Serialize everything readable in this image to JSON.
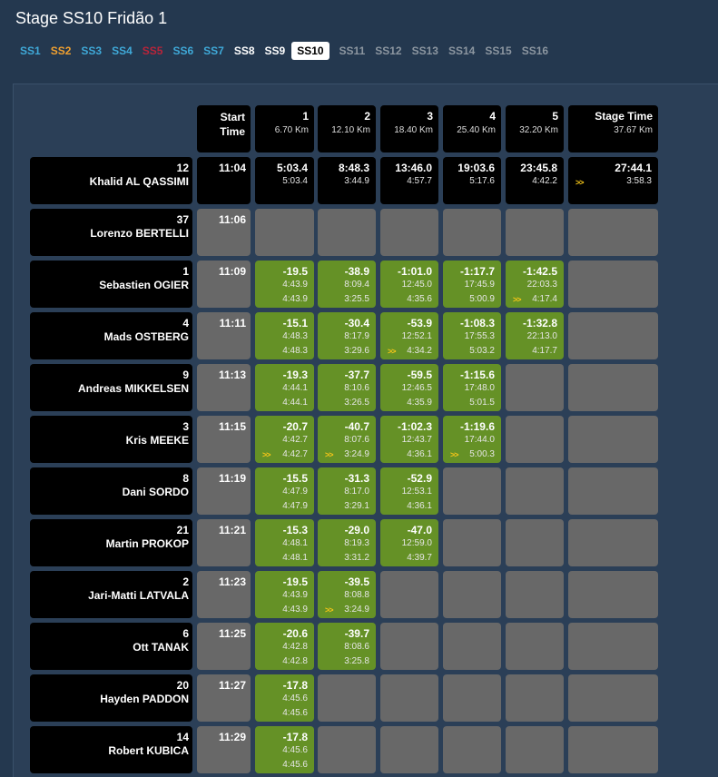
{
  "title": "Stage SS10 Fridão 1",
  "tabs": [
    {
      "label": "SS1",
      "color": "#3fa9d8",
      "active": false
    },
    {
      "label": "SS2",
      "color": "#f0a030",
      "active": false
    },
    {
      "label": "SS3",
      "color": "#3fa9d8",
      "active": false
    },
    {
      "label": "SS4",
      "color": "#3fa9d8",
      "active": false
    },
    {
      "label": "SS5",
      "color": "#b8243a",
      "active": false
    },
    {
      "label": "SS6",
      "color": "#3fa9d8",
      "active": false
    },
    {
      "label": "SS7",
      "color": "#3fa9d8",
      "active": false
    },
    {
      "label": "SS8",
      "color": "#ffffff",
      "active": false
    },
    {
      "label": "SS9",
      "color": "#ffffff",
      "active": false
    },
    {
      "label": "SS10",
      "color": "#000000",
      "active": true
    },
    {
      "label": "SS11",
      "color": "#8c96a0",
      "active": false
    },
    {
      "label": "SS12",
      "color": "#8c96a0",
      "active": false
    },
    {
      "label": "SS13",
      "color": "#8c96a0",
      "active": false
    },
    {
      "label": "SS14",
      "color": "#8c96a0",
      "active": false
    },
    {
      "label": "SS15",
      "color": "#8c96a0",
      "active": false
    },
    {
      "label": "SS16",
      "color": "#8c96a0",
      "active": false
    }
  ],
  "columns": {
    "start": {
      "line1": "Start",
      "line2": "Time"
    },
    "splits": [
      {
        "num": "1",
        "dist": "6.70 Km"
      },
      {
        "num": "2",
        "dist": "12.10 Km"
      },
      {
        "num": "3",
        "dist": "18.40 Km"
      },
      {
        "num": "4",
        "dist": "25.40 Km"
      },
      {
        "num": "5",
        "dist": "32.20 Km"
      }
    ],
    "stage": {
      "label": "Stage Time",
      "dist": "37.67 Km"
    }
  },
  "colors": {
    "black": "#000000",
    "grey": "#686868",
    "green": "#659126",
    "arrow": "#f5c518"
  },
  "leader": {
    "num": "12",
    "name": "Khalid AL QASSIMI",
    "start": "11:04",
    "splits": [
      {
        "v1": "5:03.4",
        "v2": "5:03.4",
        "arrow": false
      },
      {
        "v1": "8:48.3",
        "v2": "3:44.9",
        "arrow": false
      },
      {
        "v1": "13:46.0",
        "v2": "4:57.7",
        "arrow": false
      },
      {
        "v1": "19:03.6",
        "v2": "5:17.6",
        "arrow": false
      },
      {
        "v1": "23:45.8",
        "v2": "4:42.2",
        "arrow": false
      }
    ],
    "stage": {
      "v1": "27:44.1",
      "v2": "3:58.3",
      "arrow": true
    }
  },
  "drivers": [
    {
      "num": "37",
      "name": "Lorenzo BERTELLI",
      "start": "11:06",
      "splits": []
    },
    {
      "num": "1",
      "name": "Sebastien OGIER",
      "start": "11:09",
      "splits": [
        {
          "v1": "-19.5",
          "v2": "4:43.9",
          "v3": "4:43.9",
          "arrow": false
        },
        {
          "v1": "-38.9",
          "v2": "8:09.4",
          "v3": "3:25.5",
          "arrow": false
        },
        {
          "v1": "-1:01.0",
          "v2": "12:45.0",
          "v3": "4:35.6",
          "arrow": false
        },
        {
          "v1": "-1:17.7",
          "v2": "17:45.9",
          "v3": "5:00.9",
          "arrow": false
        },
        {
          "v1": "-1:42.5",
          "v2": "22:03.3",
          "v3": "4:17.4",
          "arrow": true
        }
      ]
    },
    {
      "num": "4",
      "name": "Mads OSTBERG",
      "start": "11:11",
      "splits": [
        {
          "v1": "-15.1",
          "v2": "4:48.3",
          "v3": "4:48.3",
          "arrow": false
        },
        {
          "v1": "-30.4",
          "v2": "8:17.9",
          "v3": "3:29.6",
          "arrow": false
        },
        {
          "v1": "-53.9",
          "v2": "12:52.1",
          "v3": "4:34.2",
          "arrow": true
        },
        {
          "v1": "-1:08.3",
          "v2": "17:55.3",
          "v3": "5:03.2",
          "arrow": false
        },
        {
          "v1": "-1:32.8",
          "v2": "22:13.0",
          "v3": "4:17.7",
          "arrow": false
        }
      ]
    },
    {
      "num": "9",
      "name": "Andreas MIKKELSEN",
      "start": "11:13",
      "splits": [
        {
          "v1": "-19.3",
          "v2": "4:44.1",
          "v3": "4:44.1",
          "arrow": false
        },
        {
          "v1": "-37.7",
          "v2": "8:10.6",
          "v3": "3:26.5",
          "arrow": false
        },
        {
          "v1": "-59.5",
          "v2": "12:46.5",
          "v3": "4:35.9",
          "arrow": false
        },
        {
          "v1": "-1:15.6",
          "v2": "17:48.0",
          "v3": "5:01.5",
          "arrow": false
        }
      ]
    },
    {
      "num": "3",
      "name": "Kris MEEKE",
      "start": "11:15",
      "splits": [
        {
          "v1": "-20.7",
          "v2": "4:42.7",
          "v3": "4:42.7",
          "arrow": true
        },
        {
          "v1": "-40.7",
          "v2": "8:07.6",
          "v3": "3:24.9",
          "arrow": true
        },
        {
          "v1": "-1:02.3",
          "v2": "12:43.7",
          "v3": "4:36.1",
          "arrow": false
        },
        {
          "v1": "-1:19.6",
          "v2": "17:44.0",
          "v3": "5:00.3",
          "arrow": true
        }
      ]
    },
    {
      "num": "8",
      "name": "Dani SORDO",
      "start": "11:19",
      "splits": [
        {
          "v1": "-15.5",
          "v2": "4:47.9",
          "v3": "4:47.9",
          "arrow": false
        },
        {
          "v1": "-31.3",
          "v2": "8:17.0",
          "v3": "3:29.1",
          "arrow": false
        },
        {
          "v1": "-52.9",
          "v2": "12:53.1",
          "v3": "4:36.1",
          "arrow": false
        }
      ]
    },
    {
      "num": "21",
      "name": "Martin PROKOP",
      "start": "11:21",
      "splits": [
        {
          "v1": "-15.3",
          "v2": "4:48.1",
          "v3": "4:48.1",
          "arrow": false
        },
        {
          "v1": "-29.0",
          "v2": "8:19.3",
          "v3": "3:31.2",
          "arrow": false
        },
        {
          "v1": "-47.0",
          "v2": "12:59.0",
          "v3": "4:39.7",
          "arrow": false
        }
      ]
    },
    {
      "num": "2",
      "name": "Jari-Matti LATVALA",
      "start": "11:23",
      "splits": [
        {
          "v1": "-19.5",
          "v2": "4:43.9",
          "v3": "4:43.9",
          "arrow": false
        },
        {
          "v1": "-39.5",
          "v2": "8:08.8",
          "v3": "3:24.9",
          "arrow": true
        }
      ]
    },
    {
      "num": "6",
      "name": "Ott TANAK",
      "start": "11:25",
      "splits": [
        {
          "v1": "-20.6",
          "v2": "4:42.8",
          "v3": "4:42.8",
          "arrow": false
        },
        {
          "v1": "-39.7",
          "v2": "8:08.6",
          "v3": "3:25.8",
          "arrow": false
        }
      ]
    },
    {
      "num": "20",
      "name": "Hayden PADDON",
      "start": "11:27",
      "splits": [
        {
          "v1": "-17.8",
          "v2": "4:45.6",
          "v3": "4:45.6",
          "arrow": false
        }
      ]
    },
    {
      "num": "14",
      "name": "Robert KUBICA",
      "start": "11:29",
      "splits": [
        {
          "v1": "-17.8",
          "v2": "4:45.6",
          "v3": "4:45.6",
          "arrow": false
        }
      ]
    }
  ],
  "arrow_glyph": ">>"
}
